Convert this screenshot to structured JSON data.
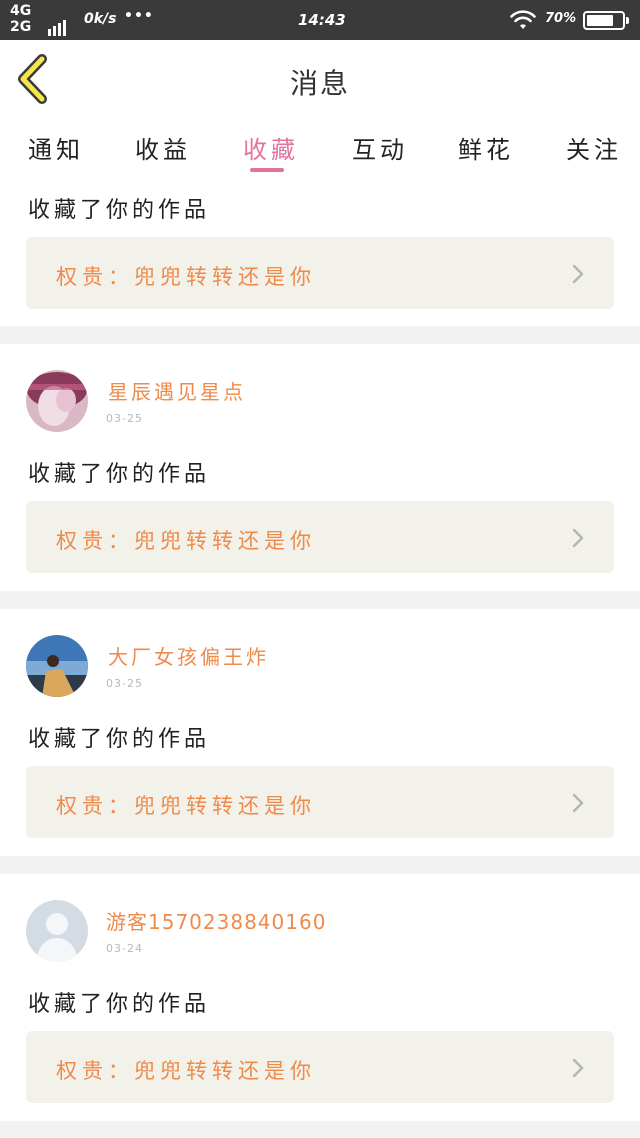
{
  "status_bar": {
    "network_top": "4G",
    "network_bottom": "2G",
    "speed": "0k/s",
    "dots": "•••",
    "time": "14:43",
    "battery": "70%"
  },
  "header": {
    "title": "消息"
  },
  "tabs": [
    {
      "label": "通知"
    },
    {
      "label": "收益"
    },
    {
      "label": "收藏",
      "active": true
    },
    {
      "label": "互动"
    },
    {
      "label": "鲜花"
    },
    {
      "label": "关注"
    }
  ],
  "colors": {
    "accent": "#e2729e",
    "name": "#f08a4b",
    "work_bg": "#f3f2ea"
  },
  "notifications": [
    {
      "action": "收藏了你的作品",
      "work": "权贵：兜兜转转还是你"
    },
    {
      "user": "星辰遇见星点",
      "date": "03-25",
      "avatar": "avatar-pink",
      "action": "收藏了你的作品",
      "work": "权贵：兜兜转转还是你"
    },
    {
      "user": "大厂女孩偏王炸",
      "date": "03-25",
      "avatar": "avatar-photo",
      "action": "收藏了你的作品",
      "work": "权贵：兜兜转转还是你"
    },
    {
      "user": "游客1570238840160",
      "date": "03-24",
      "avatar": "avatar-default",
      "action": "收藏了你的作品",
      "work": "权贵：兜兜转转还是你"
    }
  ]
}
